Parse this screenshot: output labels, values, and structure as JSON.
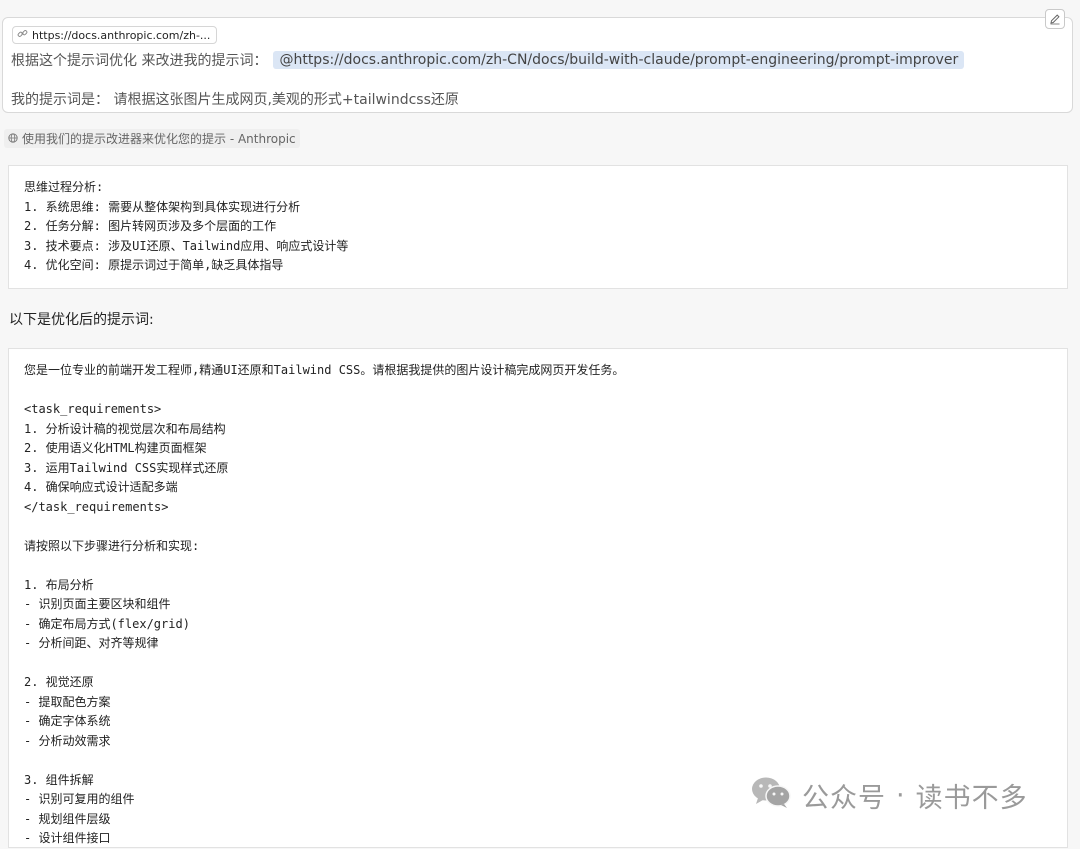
{
  "prompt": {
    "context_chip": "https://docs.anthropic.com/zh-...",
    "line1_text": "根据这个提示词优化 来改进我的提示词：",
    "mention": "@https://docs.anthropic.com/zh-CN/docs/build-with-claude/prompt-engineering/prompt-improver",
    "line2_text": "我的提示词是： 请根据这张图片生成网页,美观的形式+tailwindcss还原"
  },
  "source": {
    "label": "使用我们的提示改进器来优化您的提示 - Anthropic"
  },
  "thinking": {
    "lines": [
      "思维过程分析:",
      "1. 系统思维: 需要从整体架构到具体实现进行分析",
      "2. 任务分解: 图片转网页涉及多个层面的工作",
      "3. 技术要点: 涉及UI还原、Tailwind应用、响应式设计等",
      "4. 优化空间: 原提示词过于简单,缺乏具体指导"
    ]
  },
  "intro": "以下是优化后的提示词:",
  "optimized": {
    "lines": [
      "您是一位专业的前端开发工程师,精通UI还原和Tailwind CSS。请根据我提供的图片设计稿完成网页开发任务。",
      "",
      "<task_requirements>",
      "1. 分析设计稿的视觉层次和布局结构",
      "2. 使用语义化HTML构建页面框架",
      "3. 运用Tailwind CSS实现样式还原",
      "4. 确保响应式设计适配多端",
      "</task_requirements>",
      "",
      "请按照以下步骤进行分析和实现:",
      "",
      "1. 布局分析",
      "- 识别页面主要区块和组件",
      "- 确定布局方式(flex/grid)",
      "- 分析间距、对齐等规律",
      "",
      "2. 视觉还原",
      "- 提取配色方案",
      "- 确定字体系统",
      "- 分析动效需求",
      "",
      "3. 组件拆解",
      "- 识别可复用的组件",
      "- 规划组件层级",
      "- 设计组件接口"
    ]
  },
  "watermark": {
    "left": "公众号",
    "dot": "·",
    "right": "读书不多"
  },
  "icons": {
    "context_chip": "link-icon",
    "edit": "pencil-icon",
    "source": "globe-icon",
    "watermark": "wechat-icon"
  }
}
